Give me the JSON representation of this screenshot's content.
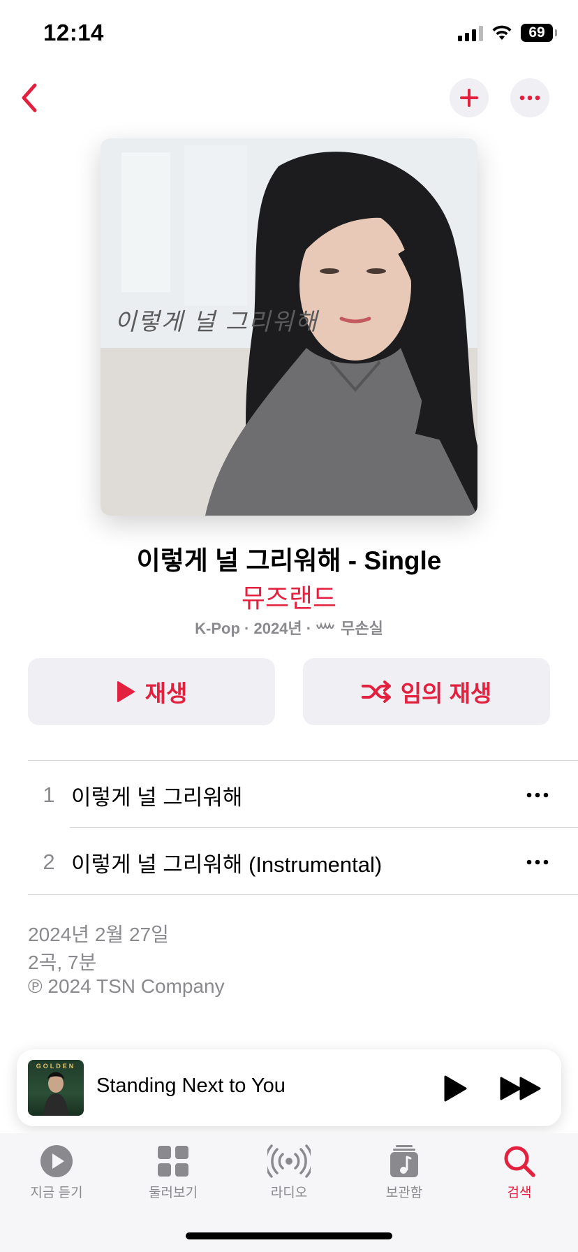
{
  "status_bar": {
    "time": "12:14",
    "battery": "69"
  },
  "album": {
    "artwork_text": "이렇게 널 그리워해",
    "title": "이렇게 널 그리워해 - Single",
    "artist": "뮤즈랜드",
    "meta_genre_year": "K-Pop · 2024년 ·",
    "meta_label": "무손실"
  },
  "actions": {
    "play": "재생",
    "shuffle": "임의 재생"
  },
  "tracks": [
    {
      "number": "1",
      "title": "이렇게 널 그리워해"
    },
    {
      "number": "2",
      "title": "이렇게 널 그리워해 (Instrumental)"
    }
  ],
  "info": {
    "release_date": "2024년 2월 27일",
    "summary": "2곡, 7분",
    "copyright": "℗ 2024 TSN Company"
  },
  "mini_player": {
    "art_label": "GOLDEN",
    "title": "Standing Next to You"
  },
  "tabs": [
    {
      "label": "지금 듣기",
      "icon": "play-circle-icon"
    },
    {
      "label": "둘러보기",
      "icon": "grid-icon"
    },
    {
      "label": "라디오",
      "icon": "radio-icon"
    },
    {
      "label": "보관함",
      "icon": "library-icon"
    },
    {
      "label": "검색",
      "icon": "search-icon",
      "active": true
    }
  ],
  "colors": {
    "accent": "#e3213f",
    "secondary_text": "#8a8a8e",
    "button_bg": "#efeff4"
  }
}
